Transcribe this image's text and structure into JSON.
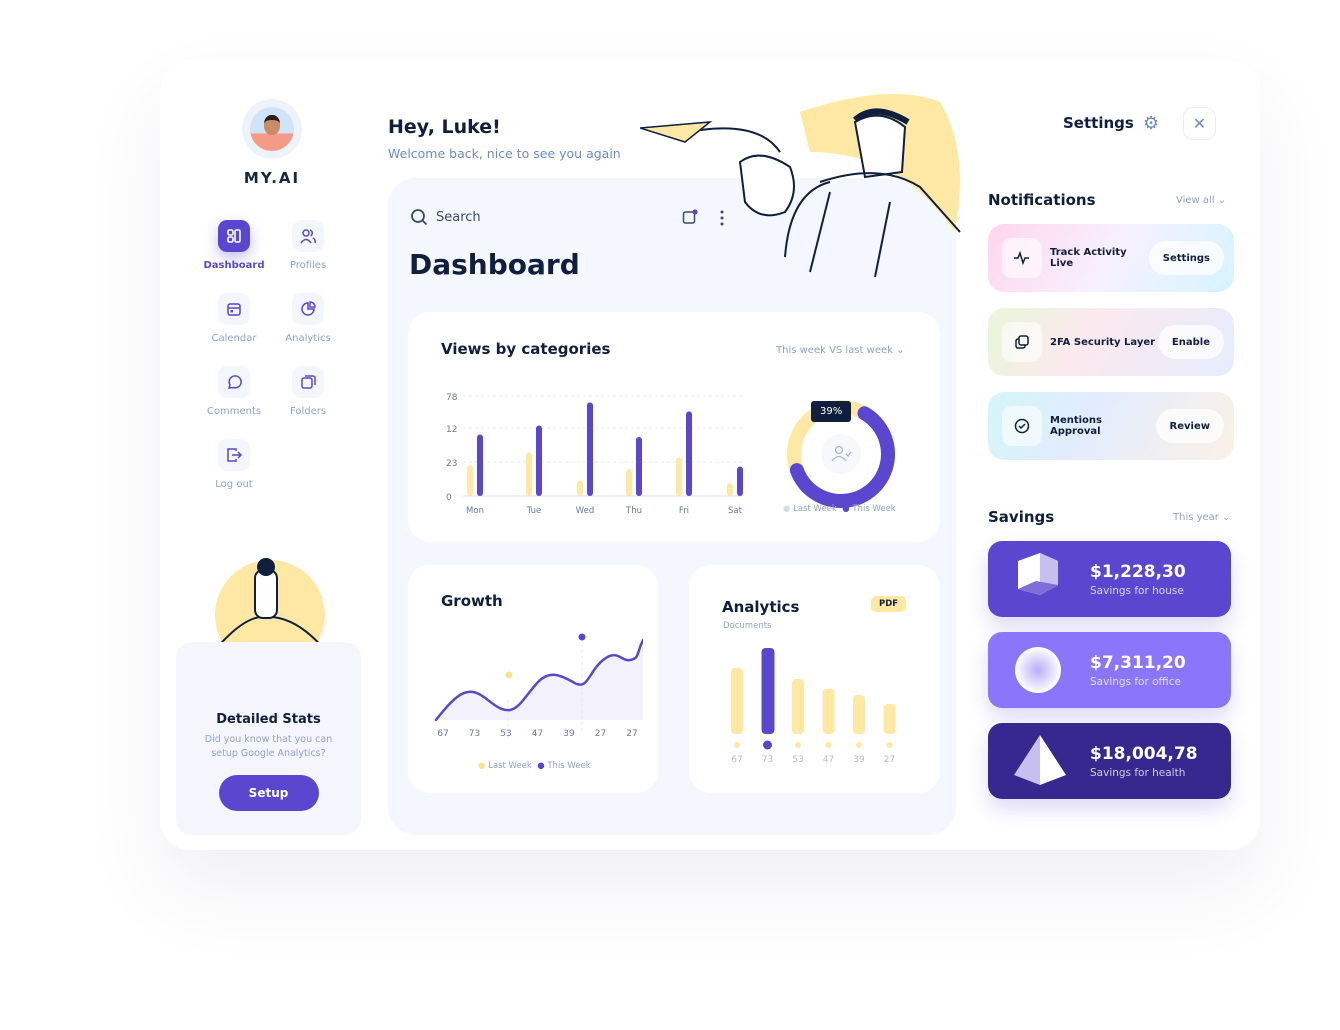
{
  "brand": "MY.AI",
  "sidebar": {
    "items": [
      {
        "label": "Dashboard",
        "icon": "dashboard-icon"
      },
      {
        "label": "Profiles",
        "icon": "users-icon"
      },
      {
        "label": "Calendar",
        "icon": "calendar-icon"
      },
      {
        "label": "Analytics",
        "icon": "pie-chart-icon"
      },
      {
        "label": "Comments",
        "icon": "comment-icon"
      },
      {
        "label": "Folders",
        "icon": "folders-icon"
      },
      {
        "label": "Log out",
        "icon": "logout-icon"
      }
    ]
  },
  "promo": {
    "title": "Detailed Stats",
    "text": "Did you know that you can setup Google Analytics?",
    "button": "Setup"
  },
  "header": {
    "greeting": "Hey, Luke!",
    "subtitle": "Welcome back, nice to see you again",
    "search": "Search",
    "title": "Dashboard"
  },
  "views": {
    "title": "Views by categories",
    "filter": "This week VS last week",
    "yticks": [
      "78",
      "12",
      "23",
      "0"
    ],
    "donut_label": "39%",
    "legend": [
      "Last Week",
      "This Week"
    ]
  },
  "growth": {
    "title": "Growth",
    "xlabels": [
      "67",
      "73",
      "53",
      "47",
      "39",
      "27",
      "27"
    ],
    "legend": [
      "Last Week",
      "This Week"
    ]
  },
  "analytics": {
    "title": "Analytics",
    "subtitle": "Documents",
    "badge": "PDF",
    "xlabels": [
      "67",
      "73",
      "53",
      "47",
      "39",
      "27"
    ]
  },
  "settings": {
    "label": "Settings"
  },
  "notifications": {
    "title": "Notifications",
    "view_all": "View all",
    "items": [
      {
        "label": "Track Activity Live",
        "action": "Settings"
      },
      {
        "label": "2FA Security Layer",
        "action": "Enable"
      },
      {
        "label": "Mentions Approval",
        "action": "Review"
      }
    ]
  },
  "savings": {
    "title": "Savings",
    "filter": "This year",
    "items": [
      {
        "amount": "$1,228,30",
        "label": "Savings for house",
        "color": "#5b47cf"
      },
      {
        "amount": "$7,311,20",
        "label": "Savings for office",
        "color": "#8a75fb"
      },
      {
        "amount": "$18,004,78",
        "label": "Savings for health",
        "color": "#37288f"
      }
    ]
  },
  "colors": {
    "accent": "#5b47cf",
    "yellow": "#ffe8a3"
  },
  "chart_data": [
    {
      "type": "bar",
      "title": "Views by categories",
      "categories": [
        "Mon",
        "Tue",
        "Wed",
        "Thu",
        "Fri",
        "Sat"
      ],
      "series": [
        {
          "name": "Last Week",
          "values": [
            24,
            34,
            12,
            21,
            30,
            10
          ]
        },
        {
          "name": "This Week",
          "values": [
            48,
            55,
            73,
            46,
            66,
            23
          ]
        }
      ],
      "ylim": [
        0,
        78
      ]
    },
    {
      "type": "pie",
      "title": "Views share",
      "slices": [
        {
          "name": "Last Week",
          "value": 39
        },
        {
          "name": "This Week",
          "value": 61
        }
      ]
    },
    {
      "type": "line",
      "title": "Growth",
      "y": [
        20,
        45,
        28,
        62,
        52,
        78,
        70,
        95
      ],
      "highlight": [
        {
          "index": 2.6,
          "series": "Last Week"
        },
        {
          "index": 5,
          "series": "This Week"
        }
      ]
    },
    {
      "type": "bar",
      "title": "Analytics",
      "categories": [
        "67",
        "73",
        "53",
        "47",
        "39",
        "27"
      ],
      "values": [
        66,
        86,
        55,
        45,
        39,
        30
      ],
      "highlight_index": 1
    }
  ]
}
